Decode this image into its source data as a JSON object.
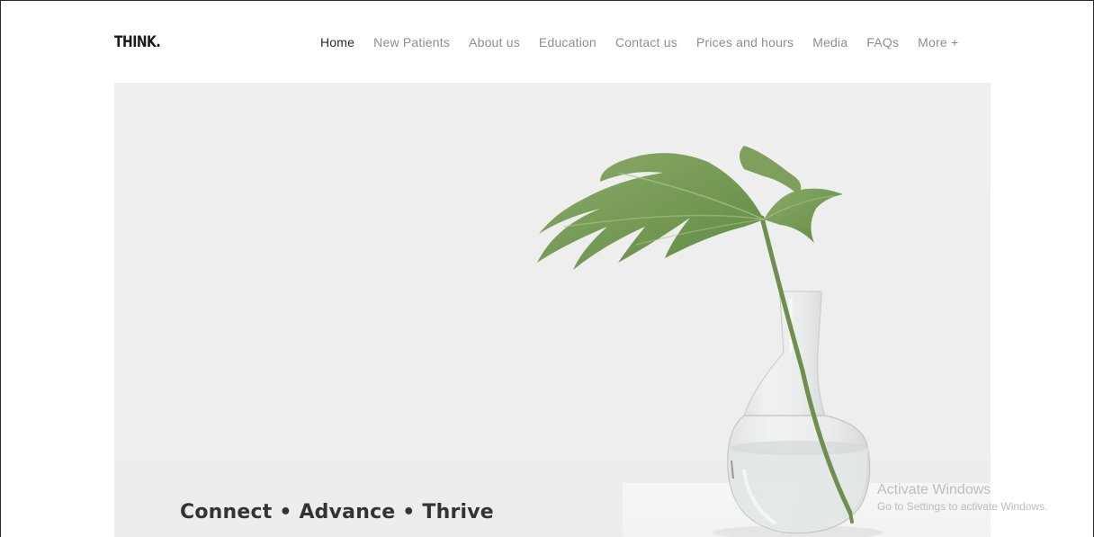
{
  "header": {
    "logo": "THINK.",
    "nav": [
      {
        "label": "Home",
        "active": true
      },
      {
        "label": "New Patients",
        "active": false
      },
      {
        "label": "About us",
        "active": false
      },
      {
        "label": "Education",
        "active": false
      },
      {
        "label": "Contact us",
        "active": false
      },
      {
        "label": "Prices and hours",
        "active": false
      },
      {
        "label": "Media",
        "active": false
      },
      {
        "label": "FAQs",
        "active": false
      },
      {
        "label": "More +",
        "active": false
      }
    ]
  },
  "hero": {
    "tagline": "Connect • Advance • Thrive",
    "image": "monstera-leaf-in-glass-vase"
  },
  "watermark": {
    "title": "Activate Windows",
    "subtitle": "Go to Settings to activate Windows."
  },
  "colors": {
    "nav_inactive": "#8e8e8e",
    "nav_active": "#2a2a2a",
    "hero_bg": "#eeeeee",
    "leaf": "#7a9a5a"
  }
}
